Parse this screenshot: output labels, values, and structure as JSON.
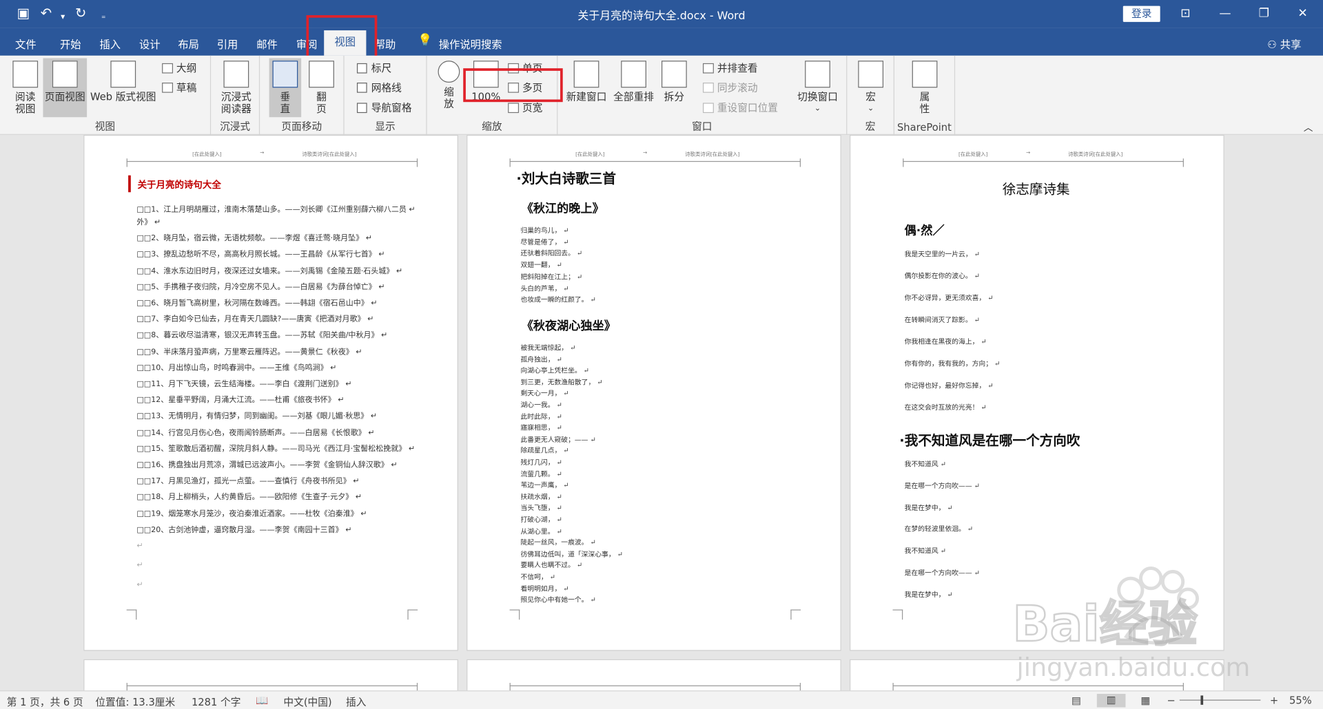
{
  "window": {
    "title": "关于月亮的诗句大全.docx  -  Word",
    "signin": "登录"
  },
  "tabs": [
    "文件",
    "开始",
    "插入",
    "设计",
    "布局",
    "引用",
    "邮件",
    "审阅",
    "视图",
    "帮助"
  ],
  "tellme": "操作说明搜索",
  "share": "共享",
  "ribbon": {
    "views": {
      "read": "阅读\n视图",
      "print": "页面视图",
      "web": "Web 版式视图",
      "outline": "大纲",
      "draft": "草稿",
      "label": "视图"
    },
    "immersive": {
      "reader": "沉浸式\n阅读器",
      "label": "沉浸式"
    },
    "move": {
      "vertical": "垂\n直",
      "side": "翻\n页",
      "label": "页面移动"
    },
    "show": {
      "ruler": "标尺",
      "grid": "网格线",
      "nav": "导航窗格",
      "label": "显示"
    },
    "zoom": {
      "zoom": "缩\n放",
      "pct": "100%",
      "one": "单页",
      "multi": "多页",
      "width": "页宽",
      "label": "缩放"
    },
    "window": {
      "new": "新建窗口",
      "arrange": "全部重排",
      "split": "拆分",
      "sidebyside": "并排查看",
      "sync": "同步滚动",
      "reset": "重设窗口位置",
      "switch": "切换窗口",
      "label": "窗口"
    },
    "macros": {
      "macro": "宏",
      "label": "宏"
    },
    "sharepoint": {
      "prop": "属\n性",
      "label": "SharePoint"
    }
  },
  "pages": {
    "hdr_left": "[在此处键入]",
    "hdr_mid": "诗歌类诗词[在此处键入]",
    "p1": {
      "title": "关于月亮的诗句大全",
      "lines": [
        "□□1、江上月明胡雁过，淮南木落楚山多。——刘长卿《江州重别薛六柳八二员",
        "外》",
        "□□2、晓月坠，宿云微，无语枕频欹。——李煜《喜迁莺·晓月坠》",
        "□□3、撩乱边愁听不尽，高高秋月照长城。——王昌龄《从军行七首》",
        "□□4、淮水东边旧时月，夜深还过女墙来。——刘禹锡《金陵五题·石头城》",
        "□□5、手携稚子夜归院，月冷空房不见人。——白居易《为薛台悼亡》",
        "□□6、晓月暂飞高树里，秋河隔在数峰西。——韩翃《宿石邑山中》",
        "□□7、李白如今已仙去，月在青天几圆缺?——唐寅《把酒对月歌》",
        "□□8、暮云收尽溢清寒，银汉无声转玉盘。——苏轼《阳关曲/中秋月》",
        "□□9、半床落月蛩声病，万里寒云雁阵迟。——黄景仁《秋夜》",
        "□□10、月出惊山鸟，时鸣春涧中。——王维《鸟鸣涧》",
        "□□11、月下飞天镜，云生结海楼。——李白《渡荆门送别》",
        "□□12、星垂平野阔，月涌大江流。——杜甫《旅夜书怀》",
        "□□13、无情明月，有情归梦，同到幽闺。——刘基《眼儿媚·秋思》",
        "□□14、行宫见月伤心色，夜雨闻铃肠断声。——白居易《长恨歌》",
        "□□15、笙歌散后酒初醒，深院月斜人静。——司马光《西江月·宝髻松松挽就》",
        "□□16、携盘独出月荒凉，渭城已远波声小。——李贺《金铜仙人辞汉歌》",
        "□□17、月黑见渔灯，孤光一点萤。——查慎行《舟夜书所见》",
        "□□18、月上柳梢头，人约黄昏后。——欧阳修《生查子·元夕》",
        "□□19、烟笼寒水月笼沙，夜泊秦淮近酒家。——杜牧《泊秦淮》",
        "□□20、古剑池钟虚，逼窍散月湿。——李贺《南园十三首》"
      ]
    },
    "p2": {
      "title": "·刘大白诗歌三首",
      "s1": "《秋江的晚上》",
      "s1lines": [
        "归巢的鸟儿，",
        "尽管是倦了，",
        "还驮着斜阳回去。",
        "双翅一翻，",
        "把斜阳掉在江上；",
        "头白的芦苇，",
        "也妆成一瞬的红颜了。"
      ],
      "s2": "《秋夜湖心独坐》",
      "s2lines": [
        "被我无端惊起，",
        "孤舟独出，",
        "向湖心亭上凭栏坐。",
        "到三更，无数渔船散了，",
        "剩天心一月，",
        "湖心一我。",
        "此时此际，",
        "寤寐相思，",
        "此番更无人窥破；——",
        "除疏星几点，",
        "残灯几闪，",
        "流萤几颗。",
        "苇边一声鹰，",
        "扶疏水烟，",
        "当头飞堕，",
        "打破心湖，",
        "从湖心里。",
        "陡起一丝风，一痕波。",
        "彷佛耳边低叫，道「深深心事，",
        "要瞒人也瞒不过。",
        "不信呵，",
        "看明明如月，",
        "照见你心中有她一个。"
      ]
    },
    "p3": {
      "title": "徐志摩诗集",
      "s1": "偶·然／",
      "s1lines": [
        "我是天空里的一片云，",
        "偶尔投影在你的波心。",
        "你不必讶异，更无须欢喜，",
        "在转瞬间消灭了踪影。",
        "你我相逢在黑夜的海上，",
        "你有你的，我有我的，方向；",
        "你记得也好，最好你忘掉，",
        "在这交会时互放的光亮！"
      ],
      "s2": "·我不知道风是在哪一个方向吹",
      "s2lines": [
        "我不知道风",
        "是在哪一个方向吹——",
        "我是在梦中，",
        "在梦的轻波里依洄。",
        "我不知道风",
        "是在哪一个方向吹——",
        "我是在梦中，"
      ]
    }
  },
  "status": {
    "page": "第 1 页，共 6 页",
    "pos": "位置值: 13.3厘米",
    "words": "1281 个字",
    "lang": "中文(中国)",
    "mode": "插入",
    "zoom": "55%"
  },
  "watermark": {
    "brand": "Bai经验",
    "url": "jingyan.baidu.com"
  }
}
